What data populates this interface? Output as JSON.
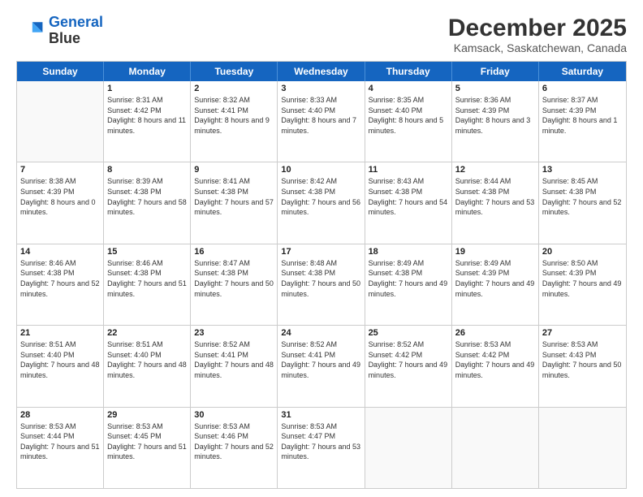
{
  "logo": {
    "line1": "General",
    "line2": "Blue"
  },
  "title": "December 2025",
  "subtitle": "Kamsack, Saskatchewan, Canada",
  "days_of_week": [
    "Sunday",
    "Monday",
    "Tuesday",
    "Wednesday",
    "Thursday",
    "Friday",
    "Saturday"
  ],
  "weeks": [
    [
      {
        "day": "",
        "sunrise": "",
        "sunset": "",
        "daylight": ""
      },
      {
        "day": "1",
        "sunrise": "Sunrise: 8:31 AM",
        "sunset": "Sunset: 4:42 PM",
        "daylight": "Daylight: 8 hours and 11 minutes."
      },
      {
        "day": "2",
        "sunrise": "Sunrise: 8:32 AM",
        "sunset": "Sunset: 4:41 PM",
        "daylight": "Daylight: 8 hours and 9 minutes."
      },
      {
        "day": "3",
        "sunrise": "Sunrise: 8:33 AM",
        "sunset": "Sunset: 4:40 PM",
        "daylight": "Daylight: 8 hours and 7 minutes."
      },
      {
        "day": "4",
        "sunrise": "Sunrise: 8:35 AM",
        "sunset": "Sunset: 4:40 PM",
        "daylight": "Daylight: 8 hours and 5 minutes."
      },
      {
        "day": "5",
        "sunrise": "Sunrise: 8:36 AM",
        "sunset": "Sunset: 4:39 PM",
        "daylight": "Daylight: 8 hours and 3 minutes."
      },
      {
        "day": "6",
        "sunrise": "Sunrise: 8:37 AM",
        "sunset": "Sunset: 4:39 PM",
        "daylight": "Daylight: 8 hours and 1 minute."
      }
    ],
    [
      {
        "day": "7",
        "sunrise": "Sunrise: 8:38 AM",
        "sunset": "Sunset: 4:39 PM",
        "daylight": "Daylight: 8 hours and 0 minutes."
      },
      {
        "day": "8",
        "sunrise": "Sunrise: 8:39 AM",
        "sunset": "Sunset: 4:38 PM",
        "daylight": "Daylight: 7 hours and 58 minutes."
      },
      {
        "day": "9",
        "sunrise": "Sunrise: 8:41 AM",
        "sunset": "Sunset: 4:38 PM",
        "daylight": "Daylight: 7 hours and 57 minutes."
      },
      {
        "day": "10",
        "sunrise": "Sunrise: 8:42 AM",
        "sunset": "Sunset: 4:38 PM",
        "daylight": "Daylight: 7 hours and 56 minutes."
      },
      {
        "day": "11",
        "sunrise": "Sunrise: 8:43 AM",
        "sunset": "Sunset: 4:38 PM",
        "daylight": "Daylight: 7 hours and 54 minutes."
      },
      {
        "day": "12",
        "sunrise": "Sunrise: 8:44 AM",
        "sunset": "Sunset: 4:38 PM",
        "daylight": "Daylight: 7 hours and 53 minutes."
      },
      {
        "day": "13",
        "sunrise": "Sunrise: 8:45 AM",
        "sunset": "Sunset: 4:38 PM",
        "daylight": "Daylight: 7 hours and 52 minutes."
      }
    ],
    [
      {
        "day": "14",
        "sunrise": "Sunrise: 8:46 AM",
        "sunset": "Sunset: 4:38 PM",
        "daylight": "Daylight: 7 hours and 52 minutes."
      },
      {
        "day": "15",
        "sunrise": "Sunrise: 8:46 AM",
        "sunset": "Sunset: 4:38 PM",
        "daylight": "Daylight: 7 hours and 51 minutes."
      },
      {
        "day": "16",
        "sunrise": "Sunrise: 8:47 AM",
        "sunset": "Sunset: 4:38 PM",
        "daylight": "Daylight: 7 hours and 50 minutes."
      },
      {
        "day": "17",
        "sunrise": "Sunrise: 8:48 AM",
        "sunset": "Sunset: 4:38 PM",
        "daylight": "Daylight: 7 hours and 50 minutes."
      },
      {
        "day": "18",
        "sunrise": "Sunrise: 8:49 AM",
        "sunset": "Sunset: 4:38 PM",
        "daylight": "Daylight: 7 hours and 49 minutes."
      },
      {
        "day": "19",
        "sunrise": "Sunrise: 8:49 AM",
        "sunset": "Sunset: 4:39 PM",
        "daylight": "Daylight: 7 hours and 49 minutes."
      },
      {
        "day": "20",
        "sunrise": "Sunrise: 8:50 AM",
        "sunset": "Sunset: 4:39 PM",
        "daylight": "Daylight: 7 hours and 49 minutes."
      }
    ],
    [
      {
        "day": "21",
        "sunrise": "Sunrise: 8:51 AM",
        "sunset": "Sunset: 4:40 PM",
        "daylight": "Daylight: 7 hours and 48 minutes."
      },
      {
        "day": "22",
        "sunrise": "Sunrise: 8:51 AM",
        "sunset": "Sunset: 4:40 PM",
        "daylight": "Daylight: 7 hours and 48 minutes."
      },
      {
        "day": "23",
        "sunrise": "Sunrise: 8:52 AM",
        "sunset": "Sunset: 4:41 PM",
        "daylight": "Daylight: 7 hours and 48 minutes."
      },
      {
        "day": "24",
        "sunrise": "Sunrise: 8:52 AM",
        "sunset": "Sunset: 4:41 PM",
        "daylight": "Daylight: 7 hours and 49 minutes."
      },
      {
        "day": "25",
        "sunrise": "Sunrise: 8:52 AM",
        "sunset": "Sunset: 4:42 PM",
        "daylight": "Daylight: 7 hours and 49 minutes."
      },
      {
        "day": "26",
        "sunrise": "Sunrise: 8:53 AM",
        "sunset": "Sunset: 4:42 PM",
        "daylight": "Daylight: 7 hours and 49 minutes."
      },
      {
        "day": "27",
        "sunrise": "Sunrise: 8:53 AM",
        "sunset": "Sunset: 4:43 PM",
        "daylight": "Daylight: 7 hours and 50 minutes."
      }
    ],
    [
      {
        "day": "28",
        "sunrise": "Sunrise: 8:53 AM",
        "sunset": "Sunset: 4:44 PM",
        "daylight": "Daylight: 7 hours and 51 minutes."
      },
      {
        "day": "29",
        "sunrise": "Sunrise: 8:53 AM",
        "sunset": "Sunset: 4:45 PM",
        "daylight": "Daylight: 7 hours and 51 minutes."
      },
      {
        "day": "30",
        "sunrise": "Sunrise: 8:53 AM",
        "sunset": "Sunset: 4:46 PM",
        "daylight": "Daylight: 7 hours and 52 minutes."
      },
      {
        "day": "31",
        "sunrise": "Sunrise: 8:53 AM",
        "sunset": "Sunset: 4:47 PM",
        "daylight": "Daylight: 7 hours and 53 minutes."
      },
      {
        "day": "",
        "sunrise": "",
        "sunset": "",
        "daylight": ""
      },
      {
        "day": "",
        "sunrise": "",
        "sunset": "",
        "daylight": ""
      },
      {
        "day": "",
        "sunrise": "",
        "sunset": "",
        "daylight": ""
      }
    ]
  ]
}
